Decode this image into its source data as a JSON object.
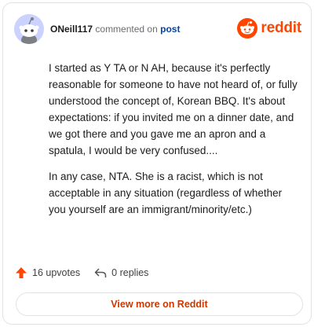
{
  "header": {
    "username": "ONeill117",
    "verb": "commented on",
    "link_text": "post",
    "brand": "reddit"
  },
  "comment": {
    "paragraphs": [
      "I started as Y TA or N AH, because it's perfectly reasonable for someone to have not heard of, or fully understood the concept of, Korean BBQ. It's about expectations: if you invited me on a dinner date, and we got there and you gave me an apron and a spatula, I would be very confused....",
      "In any case, NTA. She is a racist, which is not acceptable in any situation (regardless of whether you yourself are an immigrant/minority/etc.)"
    ]
  },
  "actions": {
    "upvotes": "16 upvotes",
    "replies": "0 replies"
  },
  "footer": {
    "view_more": "View more on Reddit"
  },
  "colors": {
    "brand": "#ff4500",
    "link": "#0045ac",
    "button_text": "#cc3700"
  },
  "icons": [
    "avatar-snoo-icon",
    "reddit-logo-icon",
    "upvote-arrow-icon",
    "reply-arrow-icon"
  ]
}
